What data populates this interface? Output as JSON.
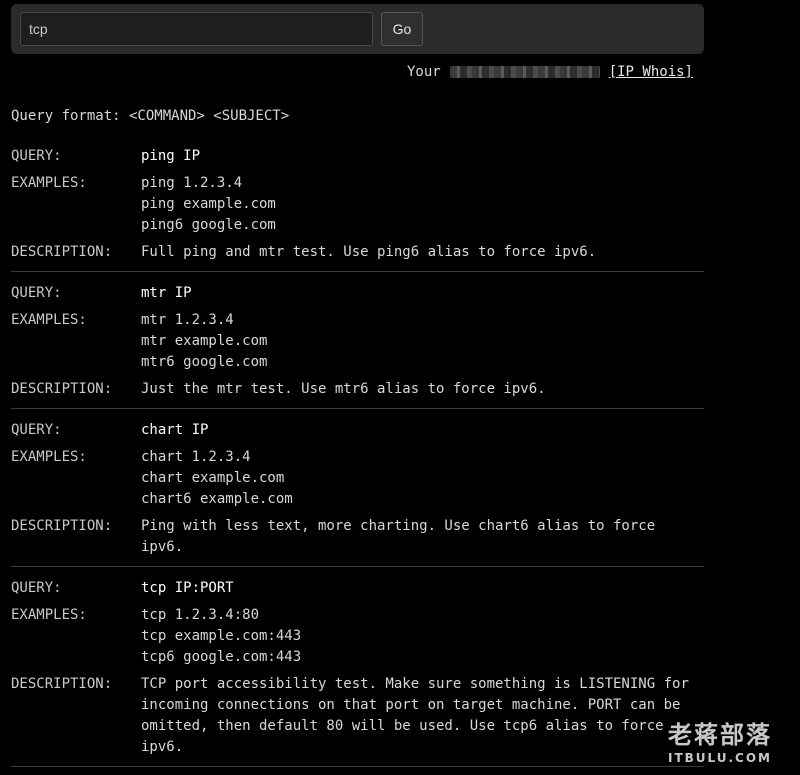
{
  "search": {
    "value": "tcp",
    "placeholder": ""
  },
  "go_label": "Go",
  "ip_line": {
    "prefix": "Your",
    "link": "[IP Whois]"
  },
  "format_line": "Query format: <COMMAND> <SUBJECT>",
  "labels": {
    "query": "QUERY:",
    "examples": "EXAMPLES:",
    "description": "DESCRIPTION:"
  },
  "sections": [
    {
      "query": "ping IP",
      "examples": [
        "ping 1.2.3.4",
        "ping example.com",
        "ping6 google.com"
      ],
      "description": "Full ping and mtr test. Use ping6 alias to force ipv6."
    },
    {
      "query": "mtr IP",
      "examples": [
        "mtr 1.2.3.4",
        "mtr example.com",
        "mtr6 google.com"
      ],
      "description": "Just the mtr test. Use mtr6 alias to force ipv6."
    },
    {
      "query": "chart IP",
      "examples": [
        "chart 1.2.3.4",
        "chart example.com",
        "chart6 example.com"
      ],
      "description": "Ping with less text, more charting. Use chart6 alias to force ipv6."
    },
    {
      "query": "tcp IP:PORT",
      "examples": [
        "tcp 1.2.3.4:80",
        "tcp example.com:443",
        "tcp6 google.com:443"
      ],
      "description": "TCP port accessibility test. Make sure something is LISTENING for incoming connections on that port on target machine. PORT can be omitted, then default 80 will be used. Use tcp6 alias to force ipv6."
    }
  ],
  "watermark": {
    "main": "老蒋部落",
    "sub": "ITBULU.COM"
  }
}
